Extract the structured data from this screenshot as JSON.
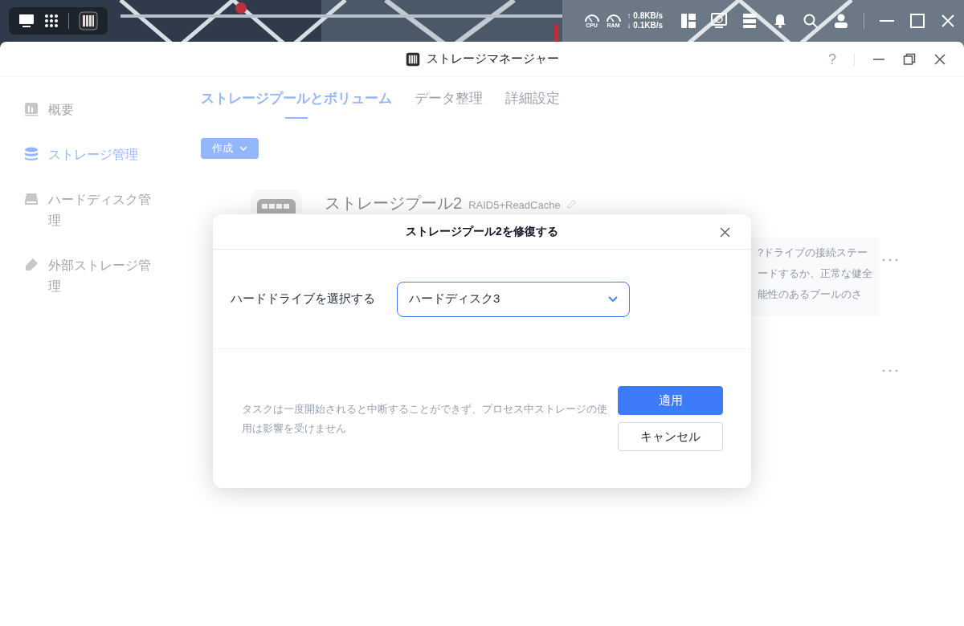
{
  "taskbar": {
    "cpu_label": "CPU",
    "ram_label": "RAM",
    "upload": "↑ 0.8KB/s",
    "download": "↓ 0.1KB/s"
  },
  "window": {
    "title": "ストレージマネージャー",
    "help": "?"
  },
  "sidebar": {
    "items": [
      {
        "label": "概要",
        "selected": false
      },
      {
        "label": "ストレージ管理",
        "selected": true
      },
      {
        "label": "ハードディスク管理",
        "selected": false
      },
      {
        "label": "外部ストレージ管理",
        "selected": false
      }
    ]
  },
  "tabs": [
    {
      "label": "ストレージプールとボリューム",
      "selected": true
    },
    {
      "label": "データ整理",
      "selected": false
    },
    {
      "label": "詳細設定",
      "selected": false
    }
  ],
  "create_button": "作成",
  "pool": {
    "name": "ストレージプール2",
    "raid": "RAID5+ReadCache",
    "notice_lines": [
      "?ドライブの接続ステー",
      "ードするか、正常な健全",
      "能性のあるプールのさ"
    ]
  },
  "dialog": {
    "title": "ストレージプール2を修復する",
    "field_label": "ハードドライブを選択する",
    "select_value": "ハードディスク3",
    "note": "タスクは一度開始されると中断することができず、プロセス中ストレージの使用は影響を受けません",
    "buttons": [
      {
        "label": "適用",
        "kind": "primary"
      },
      {
        "label": "キャンセル",
        "kind": "secondary"
      }
    ]
  }
}
